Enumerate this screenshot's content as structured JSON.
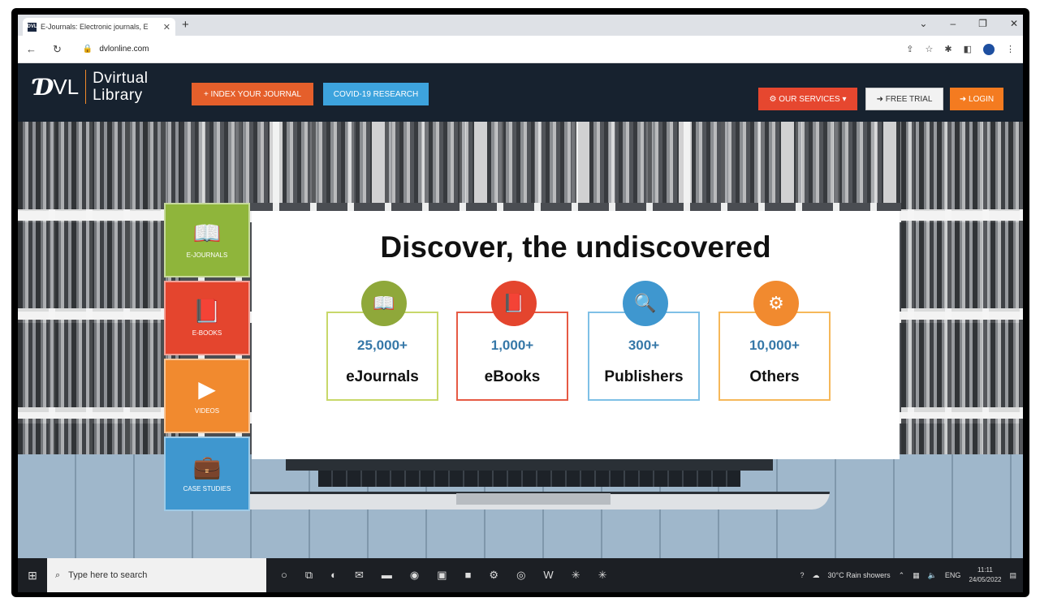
{
  "browser": {
    "tab_title": "E-Journals: Electronic journals, E",
    "favicon_text": "DVL",
    "new_tab": "+",
    "url": "dvlonline.com",
    "controls": [
      "⌄",
      "–",
      "❐",
      "✕"
    ]
  },
  "site": {
    "logo_mark": "Ɗ",
    "logo_mark2": "VL",
    "logo_line1": "Dvirtual",
    "logo_line2": "Library",
    "index_journal": "+ INDEX YOUR JOURNAL",
    "covid": "COVID-19 RESEARCH",
    "services": "⚙ OUR SERVICES ▾",
    "free_trial": "➜ FREE TRIAL",
    "login": "➜ LOGIN"
  },
  "categories": [
    {
      "label": "E-JOURNALS",
      "icon": "📖"
    },
    {
      "label": "E-BOOKS",
      "icon": "📕"
    },
    {
      "label": "VIDEOS",
      "icon": "▶"
    },
    {
      "label": "CASE STUDIES",
      "icon": "💼"
    }
  ],
  "hero": {
    "title": "Discover, the undiscovered",
    "stats": [
      {
        "value": "25,000+",
        "label": "eJournals",
        "icon": "📖",
        "color": "#8fa83a"
      },
      {
        "value": "1,000+",
        "label": "eBooks",
        "icon": "📕",
        "color": "#e4452e"
      },
      {
        "value": "300+",
        "label": "Publishers",
        "icon": "🔍",
        "color": "#3f97cf"
      },
      {
        "value": "10,000+",
        "label": "Others",
        "icon": "⚙",
        "color": "#f18a2f"
      }
    ]
  },
  "taskbar": {
    "search_placeholder": "Type here to search",
    "weather": "30°C  Rain showers",
    "lang": "ENG",
    "time": "11:11",
    "date": "24/05/2022"
  }
}
